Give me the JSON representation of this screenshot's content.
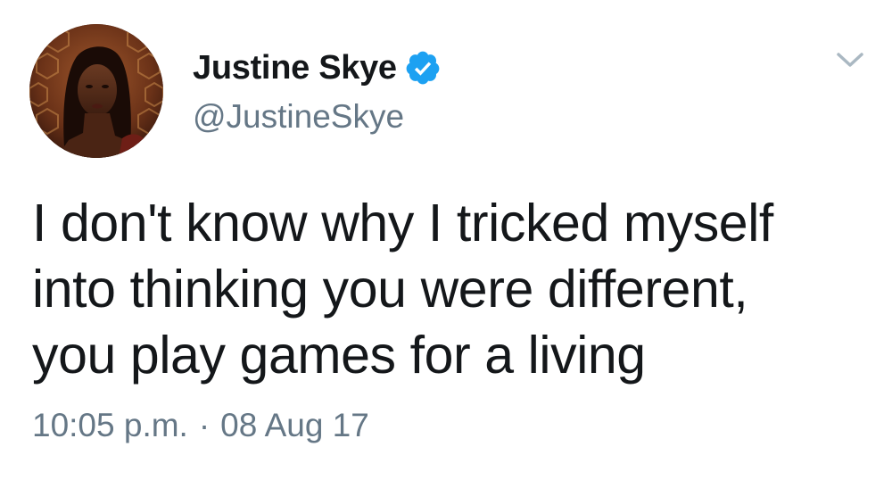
{
  "author": {
    "display_name": "Justine Skye",
    "handle": "@JustineSkye",
    "verified": true,
    "avatar_icon": "profile-photo"
  },
  "tweet": {
    "text": "I don't know why I tricked myself\ninto thinking you were different,\nyou play games for a living",
    "time": "10:05 p.m.",
    "separator": "·",
    "date": "08 Aug 17"
  },
  "icons": {
    "verified_badge": "verified-badge-icon",
    "more": "chevron-down-icon"
  },
  "colors": {
    "primary_text": "#14171a",
    "secondary_text": "#657786",
    "verified_blue": "#1da1f2",
    "chevron": "#aab8c2"
  }
}
